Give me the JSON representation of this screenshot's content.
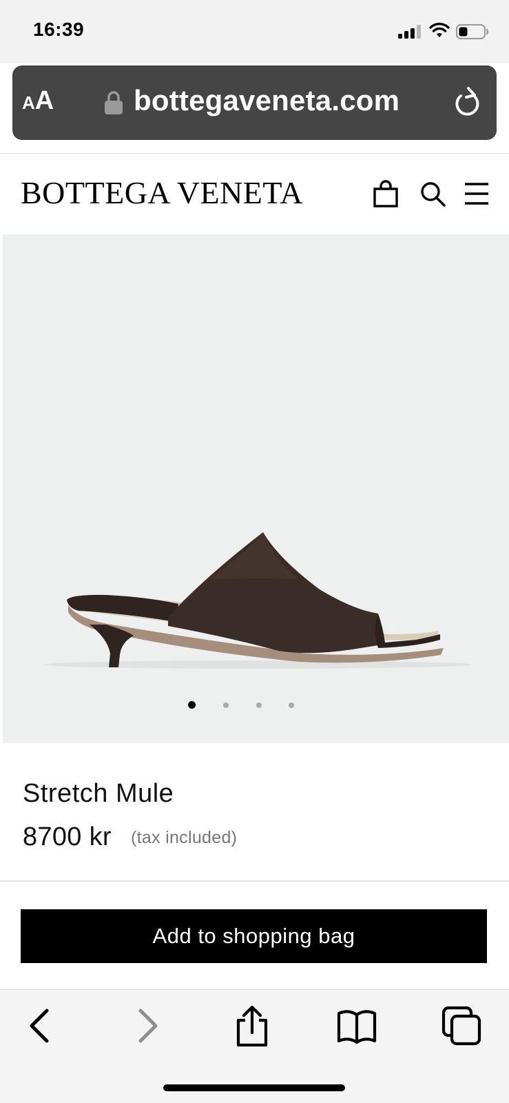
{
  "status_bar": {
    "time": "16:39",
    "icons": [
      "cellular-signal-icon",
      "wifi-icon",
      "battery-icon"
    ]
  },
  "browser": {
    "text_size_label": {
      "small": "A",
      "large": "A"
    },
    "domain": "bottegaveneta.com",
    "icons": [
      "lock-icon",
      "reload-icon"
    ]
  },
  "site_header": {
    "brand": "BOTTEGA VENETA",
    "icons": [
      "shopping-bag-icon",
      "search-icon",
      "menu-icon"
    ]
  },
  "gallery": {
    "image": "dark-brown-leather-mule-sandal",
    "page_count": 4,
    "active_index": 0
  },
  "product": {
    "name": "Stretch Mule",
    "price": "8700 kr",
    "tax_note": "(tax included)"
  },
  "cta": {
    "add_to_bag": "Add to shopping bag"
  },
  "toolbar": {
    "icons": [
      "back-icon",
      "forward-icon",
      "share-icon",
      "bookmarks-icon",
      "tabs-icon"
    ],
    "forward_enabled": false
  },
  "colors": {
    "url_bar": "#454545",
    "gallery_bg": "#eef0ef",
    "button_bg": "#000000",
    "shoe_leather": "#3a2c27"
  }
}
